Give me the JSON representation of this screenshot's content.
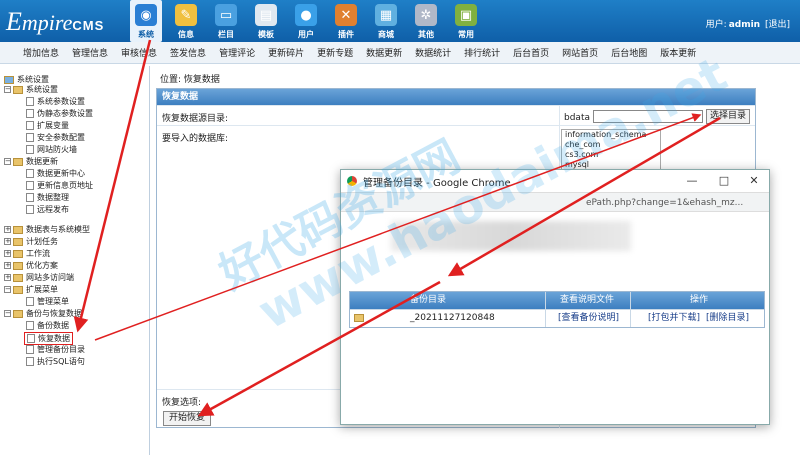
{
  "header": {
    "logo_main": "E",
    "logo_rest": "mpire",
    "logo_suffix": "CMS",
    "user_label": "用户:",
    "user_name": "admin",
    "logout": "[退出]"
  },
  "topnav": [
    {
      "label": "系统",
      "icon": "globe-icon",
      "color": "#2a7fd4"
    },
    {
      "label": "信息",
      "icon": "notepad-icon",
      "color": "#f0c040"
    },
    {
      "label": "栏目",
      "icon": "folder-icon",
      "color": "#4aa0e0"
    },
    {
      "label": "模板",
      "icon": "template-icon",
      "color": "#e0e8f0"
    },
    {
      "label": "用户",
      "icon": "user-icon",
      "color": "#3aa0e8"
    },
    {
      "label": "插件",
      "icon": "tools-icon",
      "color": "#e08030"
    },
    {
      "label": "商城",
      "icon": "shop-icon",
      "color": "#60b0e0"
    },
    {
      "label": "其他",
      "icon": "gear-icon",
      "color": "#b0b8c8"
    },
    {
      "label": "常用",
      "icon": "box-icon",
      "color": "#80b040"
    }
  ],
  "submenu": [
    "增加信息",
    "管理信息",
    "审核信息",
    "签发信息",
    "管理评论",
    "更新碎片",
    "更新专题",
    "数据更新",
    "数据统计",
    "排行统计",
    "后台首页",
    "网站首页",
    "后台地图",
    "版本更新"
  ],
  "sidebar": {
    "items": [
      {
        "label": "系统设置",
        "type": "root"
      },
      {
        "label": "系统设置",
        "type": "group"
      },
      {
        "label": "系统参数设置",
        "type": "page"
      },
      {
        "label": "伪静态参数设置",
        "type": "page"
      },
      {
        "label": "扩展变量",
        "type": "page"
      },
      {
        "label": "安全参数配置",
        "type": "page"
      },
      {
        "label": "网站防火墙",
        "type": "page"
      },
      {
        "label": "数据更新",
        "type": "group"
      },
      {
        "label": "数据更新中心",
        "type": "page"
      },
      {
        "label": "更新信息页地址",
        "type": "page"
      },
      {
        "label": "数据整理",
        "type": "page"
      },
      {
        "label": "远程发布",
        "type": "page"
      },
      {
        "label": "数据表与系统模型",
        "type": "group"
      },
      {
        "label": "计划任务",
        "type": "group"
      },
      {
        "label": "工作流",
        "type": "group"
      },
      {
        "label": "优化方案",
        "type": "group"
      },
      {
        "label": "网站多访问端",
        "type": "group"
      },
      {
        "label": "扩展菜单",
        "type": "group"
      },
      {
        "label": "管理菜单",
        "type": "page"
      },
      {
        "label": "备份与恢复数据",
        "type": "group"
      },
      {
        "label": "备份数据",
        "type": "page"
      },
      {
        "label": "恢复数据",
        "type": "page"
      },
      {
        "label": "管理备份目录",
        "type": "page"
      },
      {
        "label": "执行SQL语句",
        "type": "page"
      }
    ]
  },
  "main": {
    "breadcrumb": "位置: 恢复数据",
    "panel_title": "恢复数据",
    "restore_dir_label": "恢复数据源目录:",
    "import_db_label": "要导入的数据库:",
    "bdata_label": "bdata /",
    "select_dir_button": "选择目录",
    "db_options": [
      "information_schema",
      "che_com",
      "cs3.com",
      "mysql"
    ],
    "restore_options_label": "恢复选项:",
    "start_button": "开始恢复"
  },
  "popup": {
    "title": "管理备份目录 - Google Chrome",
    "url": "ePath.php?change=1&ehash_mz...",
    "columns": [
      "备份目录",
      "查看说明文件",
      "操作"
    ],
    "row": {
      "dir": "_20211127120848",
      "view": "[查看备份说明]",
      "download": "[打包并下载]",
      "delete": "[删除目录]"
    }
  },
  "watermark": {
    "line1": "好代码资源网",
    "line2": "www.haodaima.net"
  },
  "colors": {
    "header_blue": "#0f5fa8",
    "panel_header": "#3d7fc0",
    "arrow_red": "#e02020"
  }
}
